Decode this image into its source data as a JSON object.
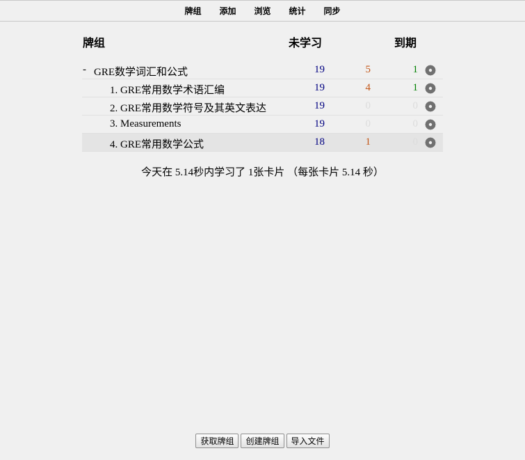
{
  "nav": {
    "items": [
      "牌组",
      "添加",
      "浏览",
      "统计",
      "同步"
    ]
  },
  "table": {
    "headers": {
      "deck": "牌组",
      "new": "未学习",
      "due": "到期"
    },
    "rows": [
      {
        "collapse": "-",
        "name": "GRE数学词汇和公式",
        "new": "19",
        "learn": "5",
        "due": "1"
      },
      {
        "name": "1. GRE常用数学术语汇编",
        "new": "19",
        "learn": "4",
        "due": "1"
      },
      {
        "name": "2. GRE常用数学符号及其英文表达",
        "new": "19",
        "learn": "0",
        "due": "0"
      },
      {
        "name": "3. Measurements",
        "new": "19",
        "learn": "0",
        "due": "0"
      },
      {
        "name": "4. GRE常用数学公式",
        "new": "18",
        "learn": "1",
        "due": "0"
      }
    ]
  },
  "summary": "今天在 5.14秒内学习了 1张卡片 （每张卡片 5.14 秒）",
  "buttons": {
    "get_shared": "获取牌组",
    "create_deck": "创建牌组",
    "import_file": "导入文件"
  },
  "colors": {
    "new": "#000080",
    "learn": "#c35617",
    "due": "#008000",
    "zero": "#dcdcdc",
    "gear": "#707070"
  },
  "icons": {
    "gear": "gear-icon",
    "collapse": "collapse-toggle"
  }
}
